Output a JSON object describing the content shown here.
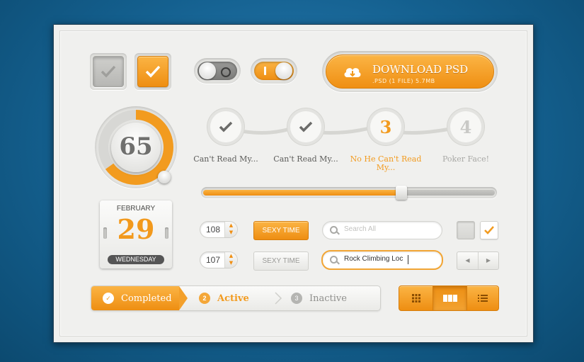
{
  "download": {
    "title": "DOWNLOAD PSD",
    "subtitle": ".PSD (1 FILE) 5.7MB"
  },
  "gauge": {
    "value": "65",
    "level_percent": 65
  },
  "steps": [
    {
      "label": "Can't Read My...",
      "state": "done",
      "icon": "check-icon"
    },
    {
      "label": "Can't Read My...",
      "state": "done",
      "icon": "check-icon"
    },
    {
      "number": "3",
      "label": "No He Can't Read My...",
      "state": "active"
    },
    {
      "number": "4",
      "label": "Poker Face!",
      "state": "inactive"
    }
  ],
  "slider": {
    "value_percent": 68
  },
  "calendar": {
    "month": "FEBRUARY",
    "day": "29",
    "weekday": "WEDNESDAY"
  },
  "steppers": [
    {
      "value": "108"
    },
    {
      "value": "107"
    }
  ],
  "buttons": {
    "primary": "SEXY TIME",
    "secondary": "SEXY TIME"
  },
  "search": {
    "placeholder": "Search All",
    "value": "Rock Climbing Loc"
  },
  "progress": {
    "completed": "Completed",
    "active": "Active",
    "active_number": "2",
    "inactive": "Inactive",
    "inactive_number": "3"
  },
  "colors": {
    "accent": "#f39a1f",
    "background": "#1a6797",
    "panel": "#f0f0ee",
    "text_muted": "#9a9a97"
  },
  "view_switcher": {
    "options": [
      "grid",
      "columns",
      "list"
    ],
    "selected": "columns"
  }
}
